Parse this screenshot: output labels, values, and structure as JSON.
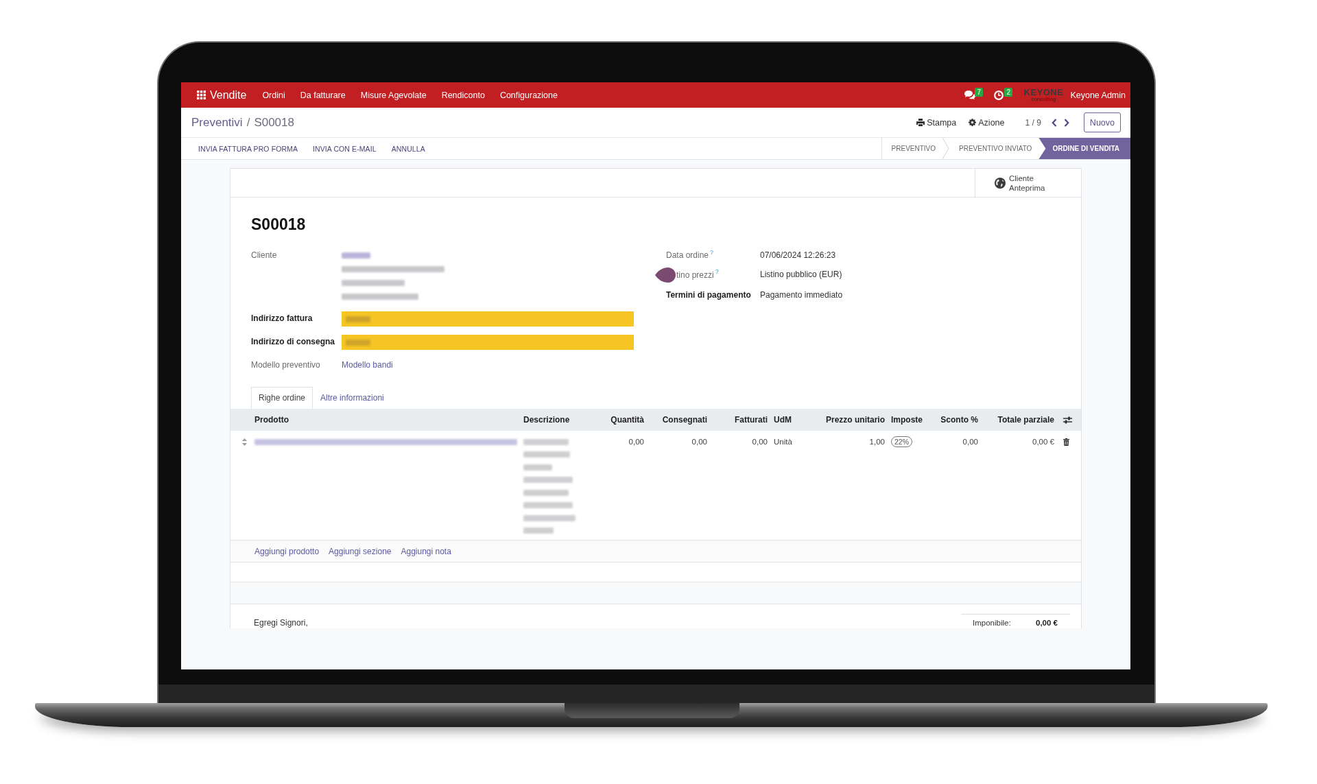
{
  "navbar": {
    "app_name": "Vendite",
    "menu": [
      "Ordini",
      "Da fatturare",
      "Misure Agevolate",
      "Rendiconto",
      "Configurazione"
    ],
    "notifications": [
      {
        "kind": "messages",
        "count": "7"
      },
      {
        "kind": "activities",
        "count": "2"
      }
    ],
    "company_logo": {
      "name": "KEYONE",
      "tagline": "consulting"
    },
    "user": "Keyone Admin"
  },
  "control_panel": {
    "breadcrumb": [
      "Preventivi",
      "S00018"
    ],
    "breadcrumb_separator": "/",
    "actions": [
      {
        "kind": "print",
        "label": "Stampa"
      },
      {
        "kind": "gear",
        "label": "Azione"
      }
    ],
    "pager": "1 / 9",
    "new_button": "Nuovo"
  },
  "status_bar": {
    "buttons": [
      "INVIA FATTURA PRO FORMA",
      "INVIA CON E-MAIL",
      "ANNULLA"
    ],
    "stages": [
      {
        "label": "PREVENTIVO",
        "selected": false
      },
      {
        "label": "PREVENTIVO INVIATO",
        "selected": false
      },
      {
        "label": "ORDINE DI VENDITA",
        "selected": true
      }
    ]
  },
  "sheet": {
    "smart_buttons": [
      {
        "kind": "globe",
        "lines": [
          "Cliente",
          "Anteprima"
        ]
      }
    ],
    "title": "S00018",
    "left_fields": [
      {
        "label": "Cliente",
        "required": false,
        "kind": "address",
        "lines": [
          {
            "redacted": true
          },
          {
            "redacted": true
          },
          {
            "redacted": true
          },
          {
            "redacted": true
          }
        ]
      },
      {
        "label": "Indirizzo fattura",
        "required": true,
        "kind": "highlight",
        "redacted": true
      },
      {
        "label": "Indirizzo di consegna",
        "required": true,
        "kind": "highlight",
        "redacted": true
      },
      {
        "label": "Modello preventivo",
        "required": false,
        "kind": "link",
        "value": "Modello bandi"
      }
    ],
    "right_fields": [
      {
        "label": "Data ordine",
        "help": "?",
        "covered": false,
        "required": false,
        "kind": "text",
        "value": "07/06/2024 12:26:23"
      },
      {
        "label": "tino prezzi",
        "help": "?",
        "covered": true,
        "required": false,
        "kind": "text",
        "value": "Listino pubblico (EUR)"
      },
      {
        "label": "Termini di pagamento",
        "covered": false,
        "required": true,
        "kind": "text",
        "value": "Pagamento immediato"
      }
    ],
    "tabs": [
      {
        "label": "Righe ordine",
        "selected": true
      },
      {
        "label": "Altre informazioni",
        "selected": false
      }
    ],
    "order_lines": {
      "columns": [
        {
          "label": "Prodotto",
          "kind": "text"
        },
        {
          "label": "Descrizione",
          "kind": "text"
        },
        {
          "label": "Quantità",
          "kind": "number"
        },
        {
          "label": "Consegnati",
          "kind": "number"
        },
        {
          "label": "Fatturati",
          "kind": "number"
        },
        {
          "label": "UdM",
          "kind": "text"
        },
        {
          "label": "Prezzo unitario",
          "kind": "number"
        },
        {
          "label": "Imposte",
          "kind": "text"
        },
        {
          "label": "Sconto %",
          "kind": "number"
        },
        {
          "label": "Totale parziale",
          "kind": "number"
        }
      ],
      "rows": [
        {
          "cells": [
            {
              "kind": "multiline",
              "lines": [
                {
                  "redacted": true
                }
              ]
            },
            {
              "kind": "multiline",
              "lines": [
                {
                  "redacted": true
                },
                {
                  "redacted": true
                },
                {
                  "redacted": true
                },
                {
                  "redacted": true
                },
                {
                  "redacted": true
                },
                {
                  "redacted": true
                },
                {
                  "redacted": true
                },
                {
                  "redacted": true
                }
              ]
            },
            {
              "kind": "plain",
              "text": "0,00"
            },
            {
              "kind": "plain",
              "text": "0,00"
            },
            {
              "kind": "plain",
              "text": "0,00"
            },
            {
              "kind": "plain",
              "text": "Unità"
            },
            {
              "kind": "plain",
              "text": "1,00"
            },
            {
              "kind": "tag",
              "text": "22%"
            },
            {
              "kind": "plain",
              "text": "0,00"
            },
            {
              "kind": "plain",
              "text": "0,00 €"
            }
          ]
        }
      ],
      "add_links": [
        "Aggiungi prodotto",
        "Aggiungi sezione",
        "Aggiungi nota"
      ]
    },
    "footer": {
      "note": "Egregi Signori,",
      "totals": [
        {
          "label": "Imponibile:",
          "value": "0,00 €"
        }
      ]
    }
  }
}
